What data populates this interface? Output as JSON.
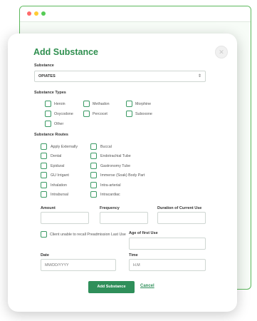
{
  "modal": {
    "title": "Add Substance"
  },
  "substance": {
    "label": "Substance",
    "selected": "OPIATES"
  },
  "types": {
    "label": "Substance Types",
    "items": [
      "Heroin",
      "Methadon",
      "Morphine",
      "Oxycodone",
      "Percocet",
      "Suboxone",
      "Other"
    ]
  },
  "routes": {
    "label": "Substance Routes",
    "left": [
      "Apply Externally",
      "Dental",
      "Epidural",
      "GU Irrigant",
      "Inhalation",
      "Intrabursal"
    ],
    "right": [
      "Buccal",
      "Endotrachial Tube",
      "Gastronomy Tube",
      "Immerse (Soak) Body Part",
      "Intra-arterial",
      "Intracardiac"
    ]
  },
  "fields": {
    "amount": "Amount",
    "frequency": "Frequency",
    "duration": "Duration of Current Use",
    "recall": "Client unable to recall Preadmission Last Use",
    "age": "Age of first Use",
    "date": "Date",
    "date_placeholder": "MM/DD/YYYY",
    "time": "Time",
    "time_placeholder": "H.M"
  },
  "actions": {
    "add": "Add Substance",
    "cancel": "Cancel"
  },
  "icons": {
    "close": "close-icon",
    "select_arrow": "updown-arrow-icon"
  }
}
